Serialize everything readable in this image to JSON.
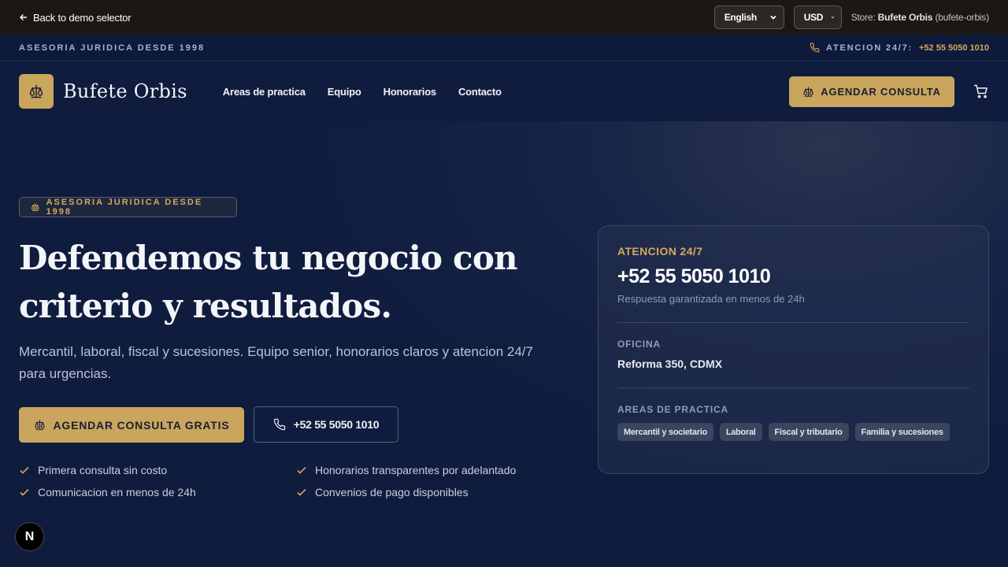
{
  "demo_bar": {
    "back_label": "Back to demo selector",
    "language": "English",
    "currency": "USD",
    "store_prefix": "Store:",
    "store_name": "Bufete Orbis",
    "store_slug": "(bufete-orbis)"
  },
  "util_strip": {
    "tagline": "ASESORIA JURIDICA DESDE 1998",
    "attention_label": "ATENCION 24/7:",
    "phone": "+52 55 5050 1010"
  },
  "nav": {
    "brand": "Bufete Orbis",
    "links": [
      "Areas de practica",
      "Equipo",
      "Honorarios",
      "Contacto"
    ],
    "cta_label": "AGENDAR CONSULTA"
  },
  "hero": {
    "badge": "ASESORIA JURIDICA DESDE 1998",
    "headline": "Defendemos tu negocio con criterio y resultados.",
    "subhead": "Mercantil, laboral, fiscal y sucesiones. Equipo senior, honorarios claros y atencion 24/7 para urgencias.",
    "primary_cta": "AGENDAR CONSULTA GRATIS",
    "secondary_cta": "+52 55 5050 1010",
    "features": [
      "Primera consulta sin costo",
      "Honorarios transparentes por adelantado",
      "Comunicacion en menos de 24h",
      "Convenios de pago disponibles"
    ]
  },
  "card": {
    "attention_label": "ATENCION 24/7",
    "phone": "+52 55 5050 1010",
    "response_note": "Respuesta garantizada en menos de 24h",
    "office_label": "OFICINA",
    "office_value": "Reforma 350, CDMX",
    "areas_label": "AREAS DE PRACTICA",
    "areas": [
      "Mercantil y societario",
      "Laboral",
      "Fiscal y tributario",
      "Familia y sucesiones"
    ]
  },
  "floating_badge": "N",
  "colors": {
    "accent_gold": "#c9a55d",
    "navy": "#0f1c3d",
    "demo_bar": "#1a1715"
  }
}
